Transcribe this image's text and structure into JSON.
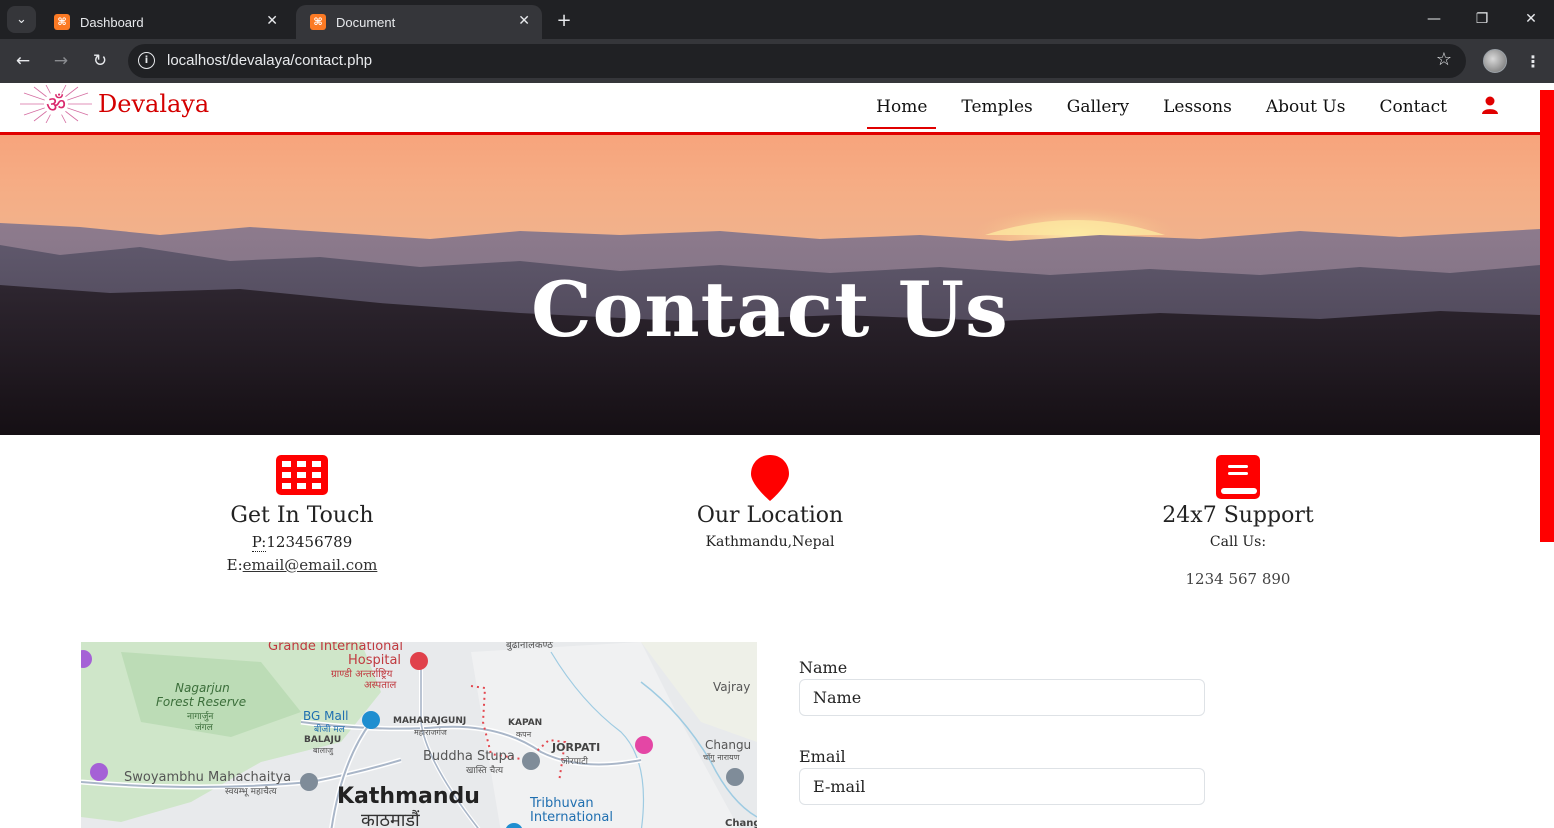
{
  "browser": {
    "tabs": [
      {
        "title": "Dashboard",
        "active": false
      },
      {
        "title": "Document",
        "active": true
      }
    ],
    "url": "localhost/devalaya/contact.php",
    "favicon_glyph": "⌘",
    "icons": [
      "tab-list-icon",
      "close-icon",
      "new-tab-icon",
      "minimize-icon",
      "restore-icon",
      "window-close-icon",
      "back-icon",
      "forward-icon",
      "reload-icon",
      "site-info-icon",
      "bookmark-star-icon",
      "profile-avatar",
      "more-menu-icon"
    ]
  },
  "site": {
    "brand": "Devalaya",
    "nav": [
      {
        "label": "Home",
        "active": true
      },
      {
        "label": "Temples",
        "active": false
      },
      {
        "label": "Gallery",
        "active": false
      },
      {
        "label": "Lessons",
        "active": false
      },
      {
        "label": "About Us",
        "active": false
      },
      {
        "label": "Contact",
        "active": false
      }
    ],
    "accent_color": "#e00000"
  },
  "hero": {
    "title": "Contact Us"
  },
  "info": {
    "touch": {
      "title": "Get In Touch",
      "phone_prefix": "P:",
      "phone": "123456789",
      "email_prefix": "E:",
      "email": "email@email.com"
    },
    "location": {
      "title": "Our Location",
      "address": "Kathmandu,Nepal"
    },
    "support": {
      "title": "24x7 Support",
      "label": "Call Us:",
      "phone": "1234 567 890"
    }
  },
  "map": {
    "labels": {
      "grande": "Grande International",
      "hospital": "Hospital",
      "hospital_np1": "ग्राण्डी अन्तर्राष्ट्रिय",
      "hospital_np2": "अस्पताल",
      "nagarjun": "Nagarjun",
      "forest": "Forest Reserve",
      "forest_np1": "नागार्जुन",
      "forest_np2": "जंगल",
      "bgmall": "BG Mall",
      "bgmall_np": "बीजी मल",
      "balaju": "BALAJU",
      "balaju_np": "बालाजु",
      "maharajgunj": "MAHARAJGUNJ",
      "maharajgunj_np": "महाराजगंज",
      "kapan": "KAPAN",
      "kapan_np": "कपन",
      "jorpati": "JORPATI",
      "jorpati_np": "जोरपाटी",
      "budhanilkantha": "बुढानीलकण्ठ",
      "vajray": "Vajray",
      "changu": "Changu",
      "changu_np": "चाँगु नारायण",
      "changun": "Changun",
      "buddha": "Buddha Stupa",
      "buddha_np": "खास्ति चैत्य",
      "swoyambhu": "Swoyambhu Mahachaitya",
      "swoyambhu_np": "स्वयम्भू महाचैत्य",
      "kathmandu": "Kathmandu",
      "kathmandu_np": "काठमाडौं",
      "tribhuvan": "Tribhuvan",
      "international": "International"
    }
  },
  "form": {
    "name_label": "Name",
    "name_placeholder": "Name",
    "email_label": "Email",
    "email_placeholder": "E-mail"
  }
}
